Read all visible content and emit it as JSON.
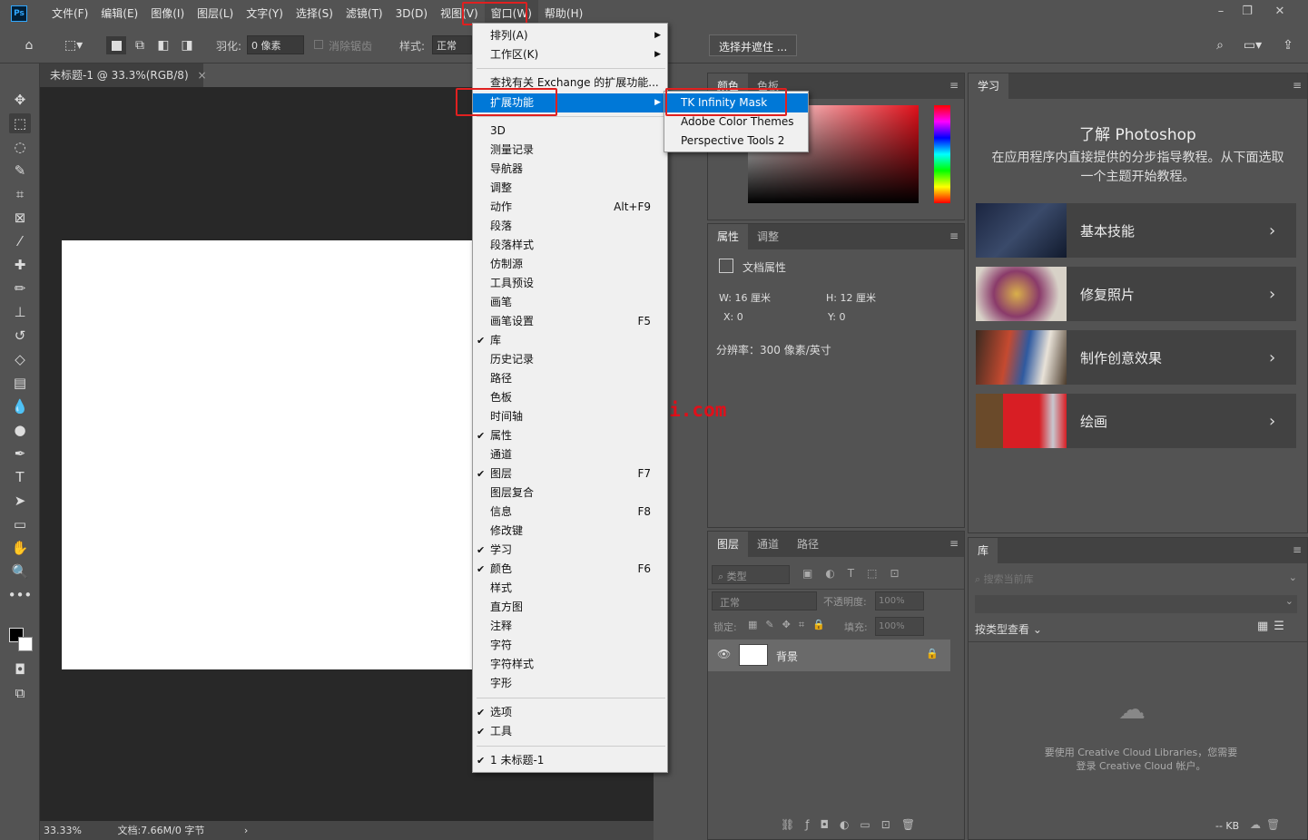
{
  "menubar": {
    "logo": "Ps",
    "items": [
      "文件(F)",
      "编辑(E)",
      "图像(I)",
      "图层(L)",
      "文字(Y)",
      "选择(S)",
      "滤镜(T)",
      "3D(D)",
      "视图(V)",
      "窗口(W)",
      "帮助(H)"
    ],
    "window_controls": [
      "–",
      "❐",
      "✕"
    ]
  },
  "options": {
    "feather_label": "羽化:",
    "feather_value": "0 像素",
    "antialias_label": "消除锯齿",
    "style_label": "样式:",
    "style_value": "正常",
    "select_mask_button": "选择并遮住 ..."
  },
  "document": {
    "tab_title": "未标题-1 @ 33.3%(RGB/8)",
    "zoom": "33.33%",
    "doc_info": "文档:7.66M/0 字节"
  },
  "window_menu": {
    "items": [
      {
        "label": "排列(A)",
        "submenu": true
      },
      {
        "label": "工作区(K)",
        "submenu": true
      },
      {
        "label": "查找有关 Exchange 的扩展功能..."
      },
      {
        "label": "扩展功能",
        "submenu": true,
        "highlighted": true
      },
      {
        "label": "3D"
      },
      {
        "label": "测量记录"
      },
      {
        "label": "导航器"
      },
      {
        "label": "调整"
      },
      {
        "label": "动作",
        "shortcut": "Alt+F9"
      },
      {
        "label": "段落"
      },
      {
        "label": "段落样式"
      },
      {
        "label": "仿制源"
      },
      {
        "label": "工具预设"
      },
      {
        "label": "画笔"
      },
      {
        "label": "画笔设置",
        "shortcut": "F5"
      },
      {
        "label": "库",
        "checked": true
      },
      {
        "label": "历史记录"
      },
      {
        "label": "路径"
      },
      {
        "label": "色板"
      },
      {
        "label": "时间轴"
      },
      {
        "label": "属性",
        "checked": true
      },
      {
        "label": "通道"
      },
      {
        "label": "图层",
        "checked": true,
        "shortcut": "F7"
      },
      {
        "label": "图层复合"
      },
      {
        "label": "信息",
        "shortcut": "F8"
      },
      {
        "label": "修改键"
      },
      {
        "label": "学习",
        "checked": true
      },
      {
        "label": "颜色",
        "checked": true,
        "shortcut": "F6"
      },
      {
        "label": "样式"
      },
      {
        "label": "直方图"
      },
      {
        "label": "注释"
      },
      {
        "label": "字符"
      },
      {
        "label": "字符样式"
      },
      {
        "label": "字形"
      },
      {
        "label": "选项",
        "checked": true
      },
      {
        "label": "工具",
        "checked": true
      },
      {
        "label": "1 未标题-1",
        "checked": true
      }
    ]
  },
  "extensions_submenu": [
    "TK Infinity Mask",
    "Adobe Color Themes",
    "Perspective Tools 2"
  ],
  "color_panel": {
    "tabs": [
      "颜色",
      "色板"
    ]
  },
  "properties_panel": {
    "tabs": [
      "属性",
      "调整"
    ],
    "doc_props_label": "文档属性",
    "w_label": "W:",
    "w_value": "16 厘米",
    "h_label": "H:",
    "h_value": "12 厘米",
    "x_label": "X:",
    "x_value": "0",
    "y_label": "Y:",
    "y_value": "0",
    "resolution": "分辨率：300 像素/英寸"
  },
  "layers_panel": {
    "tabs": [
      "图层",
      "通道",
      "路径"
    ],
    "filter_placeholder": "类型",
    "blend_mode": "正常",
    "opacity_label": "不透明度:",
    "opacity_value": "100%",
    "lock_label": "锁定:",
    "fill_label": "填充:",
    "fill_value": "100%",
    "layer_name": "背景"
  },
  "learn_panel": {
    "tab": "学习",
    "title": "了解 Photoshop",
    "subtitle": "在应用程序内直接提供的分步指导教程。从下面选取一个主题开始教程。",
    "cards": [
      "基本技能",
      "修复照片",
      "制作创意效果",
      "绘画"
    ]
  },
  "library_panel": {
    "tab": "库",
    "search_placeholder": "搜索当前库",
    "view_label": "按类型查看",
    "message": "要使用 Creative Cloud Libraries，您需要登录 Creative Cloud 帐户。",
    "size": "-- KB"
  },
  "watermark": "www.dgrai.com"
}
